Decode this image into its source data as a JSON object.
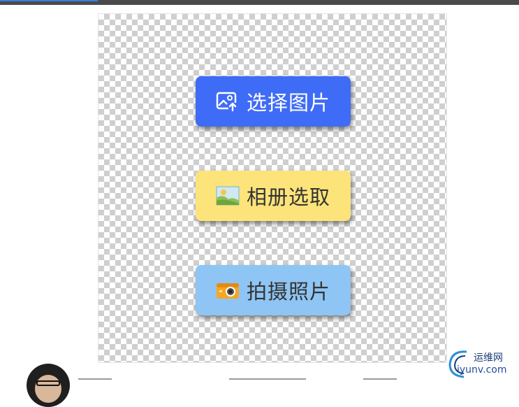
{
  "buttons": {
    "select_image": {
      "label": "选择图片",
      "icon": "image-upload-icon",
      "color": "#3f6cf6"
    },
    "album_pick": {
      "label": "相册选取",
      "icon": "landscape-photo-icon",
      "color": "#fde47a"
    },
    "take_photo": {
      "label": "拍摄照片",
      "icon": "camera-icon",
      "color": "#8ec5f4"
    }
  },
  "watermark": {
    "brand": "运维网",
    "domain": "iyunv.com"
  }
}
